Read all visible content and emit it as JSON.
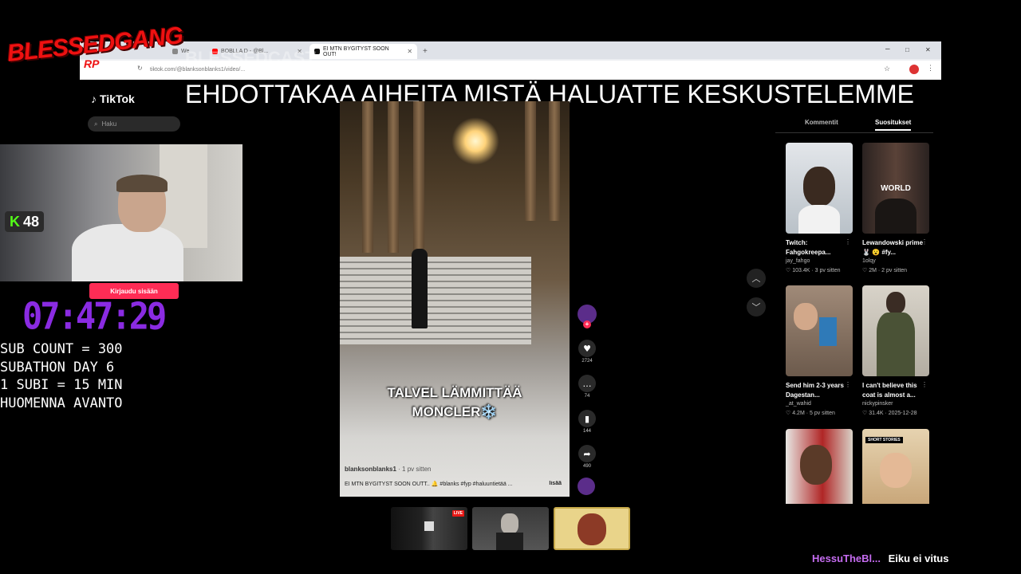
{
  "overlay": {
    "logo_text": "BLESSEDGANG",
    "logo_sub": "RP",
    "ghost_text": "BLESSEDCAST",
    "headline": "EHDOTTAKAA AIHEITA MISTÄ HALUATTE KESKUSTELEMME",
    "kick_count": "48",
    "timer": "07:47:29",
    "sub_lines": [
      "SUB COUNT = 300",
      "SUBATHON DAY 6",
      "1 SUBI = 15 MIN",
      "HUOMENNA AVANTO"
    ]
  },
  "browser": {
    "tabs": [
      {
        "label": "We"
      },
      {
        "label": "BOBLLA D - @Bl..."
      },
      {
        "label": "EI MTN BYGITYST SOON OUT!"
      }
    ],
    "new_tab": "+",
    "url": "tiktok.com/@blanksonblanks1/video/...",
    "win_min": "–",
    "win_max": "□",
    "win_close": "✕"
  },
  "tiktok": {
    "brand": "TikTok",
    "search_placeholder": "Haku",
    "login_button": "Kirjaudu sisään",
    "video": {
      "caption_line1": "TALVEL LÄMMITTÄÄ",
      "caption_line2": "MONCLER❄️",
      "author": "blanksonblanks1",
      "time": "· 1 pv sitten",
      "description": "EI MTN BYGITYST SOON OUTT.. 🔔 #blanks #fyp #haluuntietää ...",
      "more": "lisää"
    },
    "actions": [
      {
        "icon": "heart-icon",
        "glyph": "♥",
        "count": "2724"
      },
      {
        "icon": "comment-icon",
        "glyph": "…",
        "count": "74"
      },
      {
        "icon": "bookmark-icon",
        "glyph": "▮",
        "count": "144"
      },
      {
        "icon": "share-icon",
        "glyph": "➦",
        "count": "490"
      }
    ],
    "right_tabs": [
      "Kommentit",
      "Suositukset"
    ],
    "recommendations": [
      {
        "title": "Twitch: Fahgokreepa...",
        "user": "jay_fahgo",
        "meta": "♡ 103.4K · 3 pv sitten",
        "bg": "#cbd4dc"
      },
      {
        "title": "Lewandowski prime 🐰 😮 #fy...",
        "user": "1olqy",
        "meta": "♡ 2M · 2 pv sitten",
        "bg": "#3b2f2a",
        "overlay": "WORLD"
      },
      {
        "title": "Send him 2-3 years Dagestan...",
        "user": "_at_wahid",
        "meta": "♡ 4.2M · 5 pv sitten",
        "bg": "#8a7a6a"
      },
      {
        "title": "I can't believe this coat is almost a...",
        "user": "nickypinsker",
        "meta": "♡ 31.4K · 2025-12-28",
        "bg": "#c8c3b9"
      },
      {
        "title": "",
        "user": "",
        "meta": "",
        "bg": "#9a2a2a"
      },
      {
        "title": "",
        "user": "",
        "meta": "",
        "bg": "#d8c3a0",
        "overlay": "SHORT STORIES"
      }
    ]
  },
  "chat": {
    "user": "HessuTheBl...",
    "message": "Eiku ei vitus"
  }
}
